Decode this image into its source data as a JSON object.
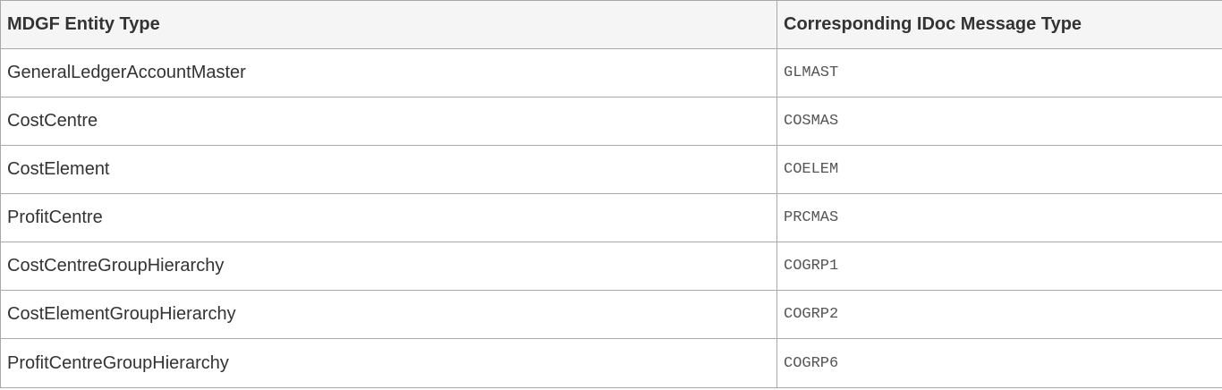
{
  "table": {
    "headers": [
      "MDGF Entity Type",
      "Corresponding IDoc Message Type"
    ],
    "rows": [
      [
        "GeneralLedgerAccountMaster",
        "GLMAST"
      ],
      [
        "CostCentre",
        "COSMAS"
      ],
      [
        "CostElement",
        "COELEM"
      ],
      [
        "ProfitCentre",
        "PRCMAS"
      ],
      [
        "CostCentreGroupHierarchy",
        "COGRP1"
      ],
      [
        "CostElementGroupHierarchy",
        "COGRP2"
      ],
      [
        "ProfitCentreGroupHierarchy",
        "COGRP6"
      ]
    ]
  }
}
